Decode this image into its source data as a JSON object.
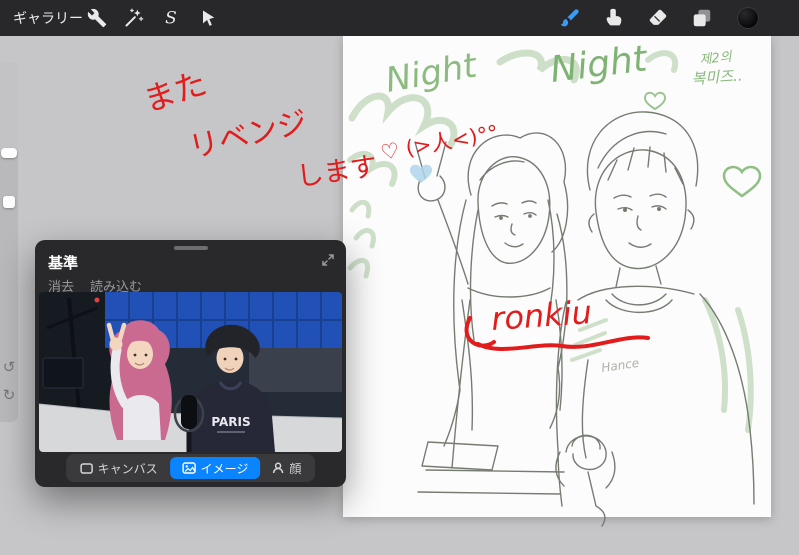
{
  "topbar": {
    "gallery": "ギャラリー",
    "selection_glyph": "S"
  },
  "sidebar_icons": {
    "undo": "↺",
    "redo": "↻"
  },
  "reference": {
    "title": "基準",
    "clear": "消去",
    "import": "読み込む",
    "tabs": [
      {
        "label": "キャンバス",
        "selected": false
      },
      {
        "label": "イメージ",
        "selected": true
      },
      {
        "label": "顔",
        "selected": false
      }
    ],
    "photo_shirt": "PARIS"
  },
  "canvas": {
    "red1": "また",
    "red2": "リベンジ",
    "red3": "します",
    "red4": "♡ (>人<)°°",
    "night1": "Night",
    "night2": "Night",
    "korean1": "제2의",
    "korean2": "복미즈..",
    "signature": "ronkiu",
    "sweater_note": "Hance"
  },
  "colors": {
    "accent_blue": "#3a9bf4",
    "selected_tab_blue": "#0a84ff",
    "annotation_red": "#e11c1c",
    "annotation_green": "#8cbb80"
  }
}
